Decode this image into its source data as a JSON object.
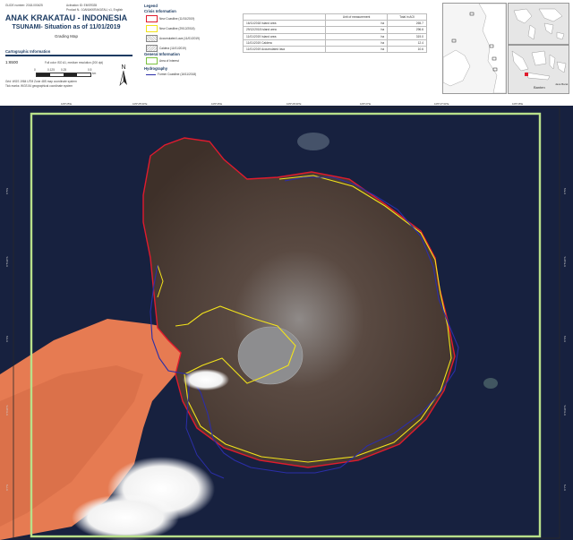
{
  "header": {
    "glide": "GLIDE number: 2018-000425",
    "activation": "Activation ID: EMSR335",
    "product": "Product N.: 10ANAKKRAKATAU, v1, English",
    "title": "ANAK KRAKATAU - INDONESIA",
    "subtitle": "TSUNAMI- Situation as of 11/01/2019",
    "map_type": "Grading Map"
  },
  "cartographic": {
    "heading": "Cartographic Information",
    "scale": "1:6500",
    "print_note": "Full color ISO A1, medium resolution (200 dpi)",
    "scale_ticks": [
      "0",
      "0.125",
      "0.25",
      "0.5"
    ],
    "scale_unit": "km",
    "grid": "Grid: WGS 1984 UTM Zone 48S map coordinate system",
    "ticks": "Tick marks: WGS 84 geographical coordinate system",
    "north": "N"
  },
  "legend": {
    "heading": "Legend",
    "crisis_heading": "Crisis Information",
    "items": [
      {
        "label": "New Coastline (11/01/2019)",
        "color": "#e01b2d"
      },
      {
        "label": "New Coastline (29/12/2018)",
        "color": "#f2e31b"
      },
      {
        "label": "Accumulated Lava (11/01/2019)",
        "color": "#b8b8b8"
      },
      {
        "label": "Caldera (11/01/2019)",
        "color": "#d0d0d0"
      }
    ],
    "general_heading": "General Information",
    "aoi_label": "Area of Interest",
    "aoi_color": "#7bc23f",
    "hydro_heading": "Hydrography",
    "former_label": "Former Coastline (16/11/2018)",
    "former_color": "#2b2ea8"
  },
  "table": {
    "headers": [
      "",
      "Unit of measurement",
      "Total in AOI"
    ],
    "rows": [
      [
        "16/11/2018 Island area",
        "ha",
        "265.7"
      ],
      [
        "29/12/2018 Island area",
        "ha",
        "296.6"
      ],
      [
        "11/01/2019 Island area",
        "ha",
        "319.0"
      ],
      [
        "11/01/2019 Caldera",
        "ha",
        "12.4"
      ],
      [
        "11/01/2019 Accumulated lava",
        "ha",
        "10.6"
      ]
    ]
  },
  "inset": {
    "label_banten": "Banten",
    "label_java": "Java Barat"
  },
  "map": {
    "lon_ticks": [
      "105°25'E",
      "105°25'30\"E",
      "105°26'E",
      "105°26'30\"E",
      "105°27'E",
      "105°27'30\"E",
      "105°28'E"
    ],
    "lat_ticks": [
      "6°5'S",
      "6°5'30\"S",
      "6°6'S",
      "6°6'30\"S",
      "6°7'S",
      "6°7'30\"S"
    ],
    "colors": {
      "sea": "#141c3a",
      "island": "#4a3c35",
      "sediment": "#e67b52",
      "aoi": "#b8e08a"
    }
  }
}
